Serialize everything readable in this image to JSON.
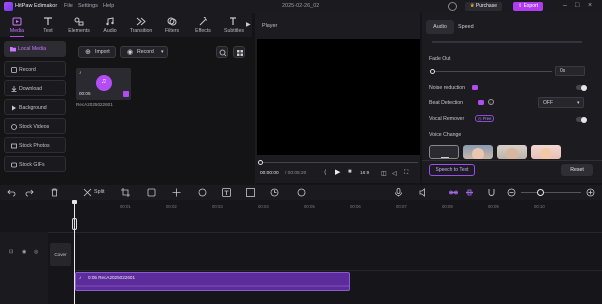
{
  "app": {
    "title": "HitPaw Edimakor",
    "menu": [
      "File",
      "Settings",
      "Help"
    ],
    "project_name": "2025-02-26_02",
    "purchase_label": "Purchase",
    "export_label": "Export"
  },
  "tools": [
    {
      "label": "Media",
      "icon": "media-icon"
    },
    {
      "label": "Text",
      "icon": "text-icon"
    },
    {
      "label": "Elements",
      "icon": "elements-icon"
    },
    {
      "label": "Audio",
      "icon": "audio-icon"
    },
    {
      "label": "Transition",
      "icon": "transition-icon"
    },
    {
      "label": "Filters",
      "icon": "filters-icon"
    },
    {
      "label": "Effects",
      "icon": "effects-icon"
    },
    {
      "label": "Subtitles",
      "icon": "subtitles-icon"
    }
  ],
  "sidebar": {
    "items": [
      {
        "label": "Local Media"
      },
      {
        "label": "Record"
      },
      {
        "label": "Download"
      },
      {
        "label": "Background"
      },
      {
        "label": "Stock Videos"
      },
      {
        "label": "Stock Photos"
      },
      {
        "label": "Stock GIFs"
      }
    ]
  },
  "media": {
    "import_label": "Import",
    "record_label": "Record",
    "clip": {
      "duration": "00:05",
      "name": "RecA2025022601"
    }
  },
  "player": {
    "label": "Player",
    "time_current": "00:00:00",
    "time_total": "/ 00:05:20",
    "quality": "16:9"
  },
  "audio_panel": {
    "tab_audio": "Audio",
    "tab_speed": "Speed",
    "fade_out_label": "Fade Out",
    "fade_out_value": "0s",
    "fade_out_level": 0,
    "noise_reduction_label": "Noise reduction",
    "beat_detection_label": "Beat Detection",
    "beat_detection_value": "OFF",
    "vocal_remover_label": "Vocal Remover",
    "free_tag": "Free",
    "voice_change_label": "Voice Change",
    "speech_to_text_label": "Speech to Text",
    "reset_label": "Reset"
  },
  "timeline": {
    "split_label": "Split",
    "ticks": [
      "00:00",
      "00:01",
      "00:02",
      "00:03",
      "00:04",
      "00:05",
      "00:06",
      "00:07",
      "00:08",
      "00:09",
      "00:10"
    ],
    "cover_label": "Cover",
    "audio_clip_label": "0:05 RecA2025022601"
  },
  "colors": {
    "accent": "#b04cf0",
    "bg": "#141416",
    "panel": "#1c1c20"
  }
}
